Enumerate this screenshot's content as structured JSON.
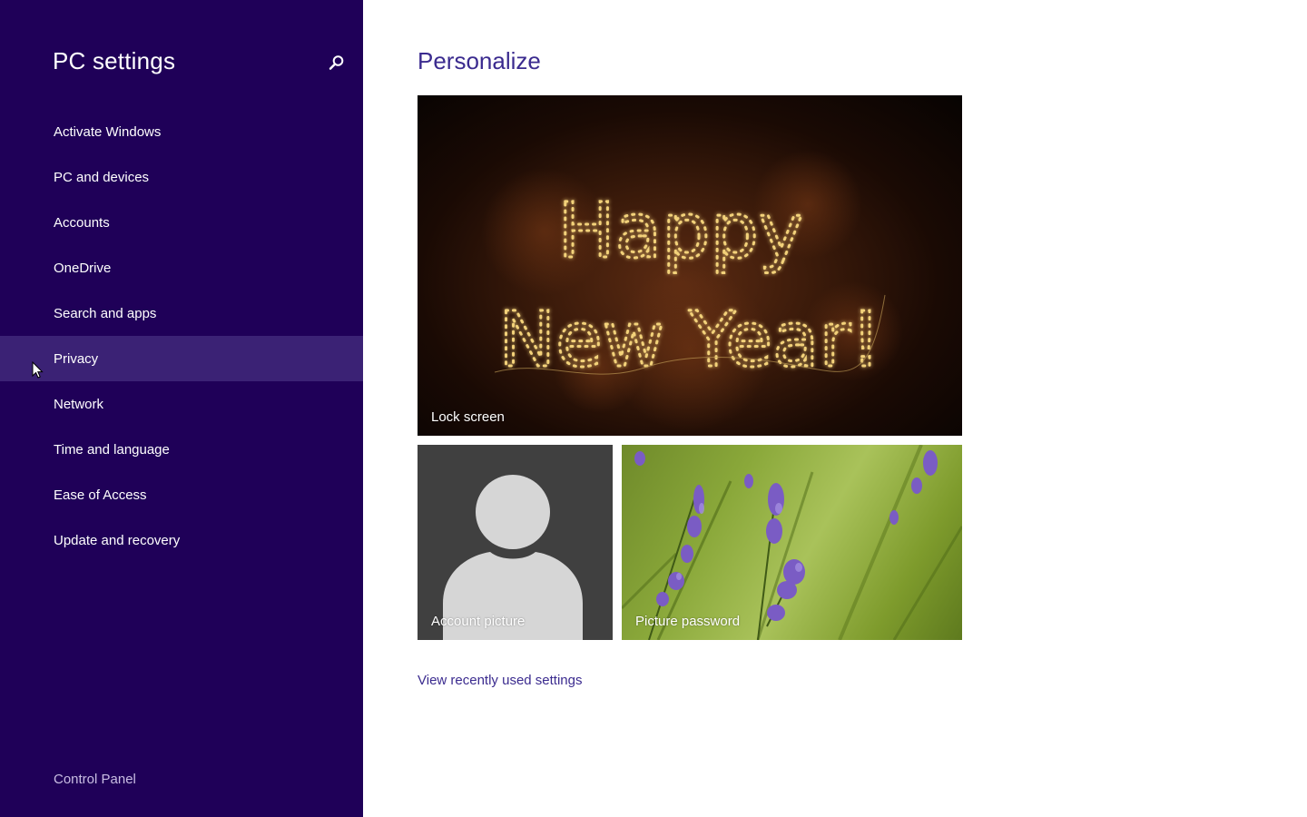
{
  "sidebar": {
    "title": "PC settings",
    "search_icon": "search-icon",
    "items": [
      {
        "label": "Activate Windows"
      },
      {
        "label": "PC and devices"
      },
      {
        "label": "Accounts"
      },
      {
        "label": "OneDrive"
      },
      {
        "label": "Search and apps"
      },
      {
        "label": "Privacy",
        "selected": true
      },
      {
        "label": "Network"
      },
      {
        "label": "Time and language"
      },
      {
        "label": "Ease of Access"
      },
      {
        "label": "Update and recovery"
      }
    ],
    "control_panel": "Control Panel"
  },
  "main": {
    "title": "Personalize",
    "tiles": {
      "lock_screen": {
        "label": "Lock screen",
        "art_line1": "Happy",
        "art_line2": "New Year!"
      },
      "account_picture": {
        "label": "Account picture"
      },
      "picture_password": {
        "label": "Picture password"
      }
    },
    "view_recent_link": "View recently used settings"
  },
  "colors": {
    "sidebar_bg": "#1f0058",
    "sidebar_selected_bg": "#3b2275",
    "accent_text": "#3b2b8f",
    "control_panel_text": "#c9bde3"
  }
}
